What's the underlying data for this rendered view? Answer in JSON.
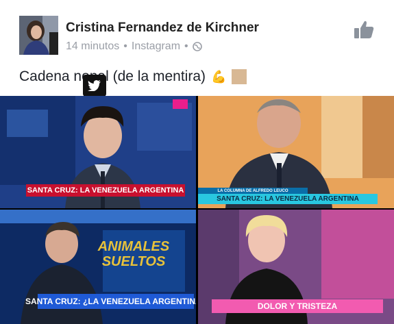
{
  "post": {
    "author": "Cristina Fernandez de Kirchner",
    "time": "14 minutos",
    "source": "Instagram",
    "separator": "•",
    "caption_before": "Cadena n",
    "caption_after": "onal (de la mentira)",
    "caption_emoji": "💪"
  },
  "tiles": {
    "tl_banner": "SANTA CRUZ: LA VENEZUELA ARGENTINA",
    "tr_banner": "SANTA CRUZ: LA VENEZUELA ARGENTINA",
    "tr_subbar": "LA COLUMNA DE ALFREDO LEUCO",
    "bl_show": "ANIMALES SUELTOS",
    "bl_banner": "SANTA CRUZ: ¿LA VENEZUELA ARGENTINA?",
    "br_banner": "DOLOR Y TRISTEZA"
  },
  "colors": {
    "accent": "#4267b2",
    "banner_red": "#c8102e",
    "banner_cyan": "#29c7e0",
    "banner_pink": "#f25bb0"
  },
  "icons": [
    "like-icon",
    "globe-icon",
    "twitter-icon"
  ]
}
